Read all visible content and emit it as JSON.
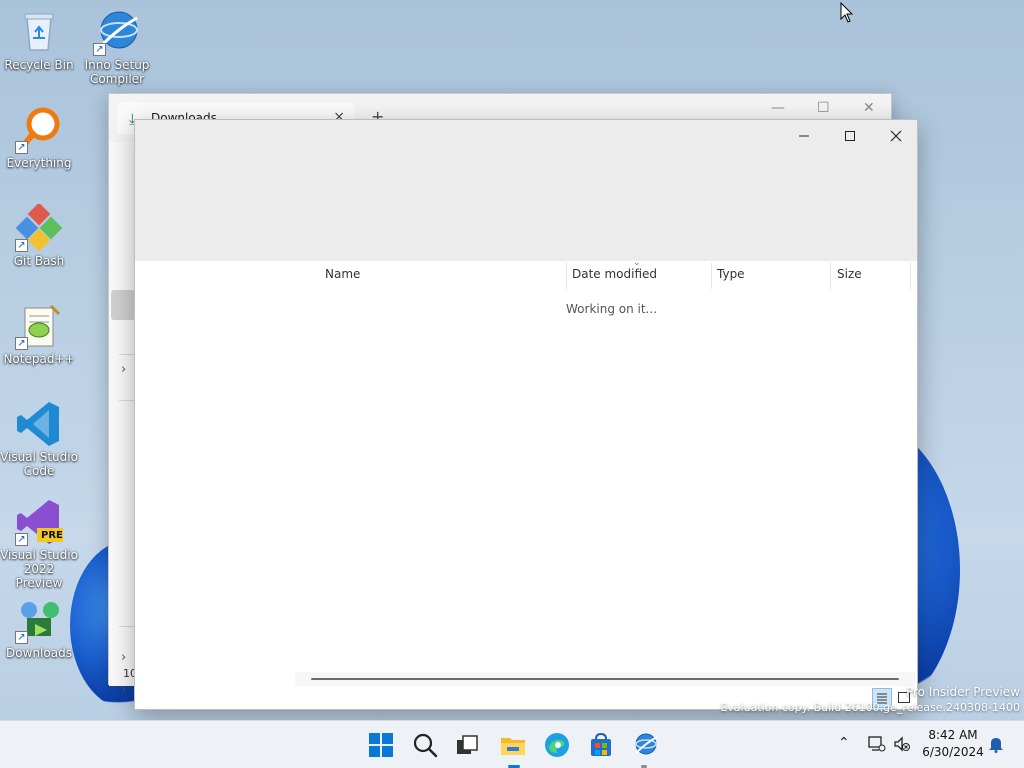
{
  "desktop": {
    "icons": [
      {
        "label": "Recycle Bin"
      },
      {
        "label": "Inno Setup Compiler"
      },
      {
        "label": "Everything"
      },
      {
        "label": "Git Bash"
      },
      {
        "label": "Notepad++"
      },
      {
        "label": "Visual Studio Code"
      },
      {
        "label": "Visual Studio 2022 Preview",
        "badge": "PRE"
      },
      {
        "label": "Downloads"
      }
    ]
  },
  "back_window": {
    "tab_title": "Downloads",
    "tab_close": "×",
    "new_tab": "+",
    "status_text": "10"
  },
  "front_window": {
    "columns": [
      "Name",
      "Date modified",
      "Type",
      "Size"
    ],
    "status_message": "Working on it..."
  },
  "watermark": {
    "line1": "Pro Insider Preview",
    "line2": "Evaluation copy. Build 26100.ge_release.240308-1400"
  },
  "taskbar": {
    "time": "8:42 AM",
    "date": "6/30/2024"
  },
  "colors": {
    "accent": "#0067c0",
    "taskbar_bg": "#eef1f6"
  }
}
